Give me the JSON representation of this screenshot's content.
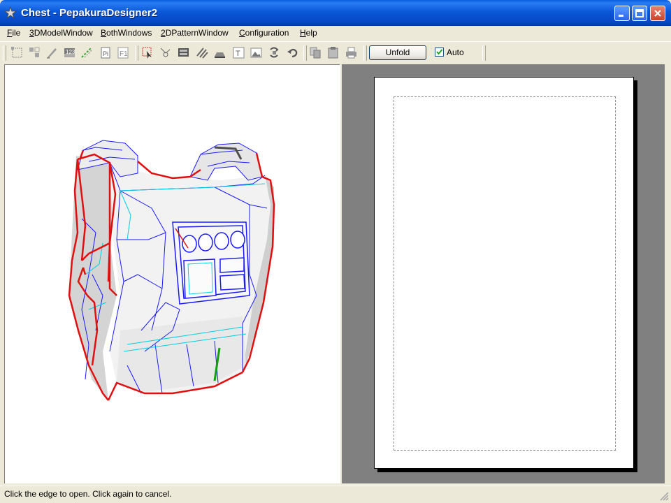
{
  "window": {
    "title": "Chest - PepakuraDesigner2",
    "app_icon": "pepakura-star-icon",
    "controls": [
      "minimize-icon",
      "maximize-icon",
      "close-icon"
    ],
    "colors": {
      "titlebar": "#0a58d8",
      "close_button": "#c8452c"
    }
  },
  "menu": {
    "items": [
      {
        "label": "File",
        "mnemonic": "F",
        "rest": "ile"
      },
      {
        "label": "3DModelWindow",
        "mnemonic": "3",
        "rest": "DModelWindow"
      },
      {
        "label": "BothWindows",
        "mnemonic": "B",
        "rest": "othWindows"
      },
      {
        "label": "2DPatternWindow",
        "mnemonic": "2",
        "rest": "DPatternWindow"
      },
      {
        "label": "Configuration",
        "mnemonic": "C",
        "rest": "onfiguration"
      },
      {
        "label": "Help",
        "mnemonic": "H",
        "rest": "elp"
      }
    ]
  },
  "toolbar": {
    "icons": [
      "select-icon",
      "move-icon",
      "edit-icon",
      "number-icon",
      "edge-icon",
      "page-icon",
      "font-icon",
      "select-face-icon",
      "join-edge-icon",
      "flap-icon",
      "flip-icon",
      "align-icon",
      "text-icon",
      "image-icon",
      "rotate-icon",
      "undo-icon",
      "copy-icon",
      "paste-icon",
      "print-icon"
    ],
    "unfold_label": "Unfold",
    "auto_label": "Auto",
    "auto_checked": true
  },
  "model_view": {
    "colors": {
      "cut_edge": "#e01010",
      "fold_edge": "#1a1aff",
      "crease_edge": "#00d0e0",
      "selected_edge": "#10a010",
      "face": "#e6e6e6"
    }
  },
  "pattern_view": {
    "colors": {
      "background": "#808080",
      "paper": "#ffffff",
      "margin": "#8c8c8c"
    }
  },
  "status": {
    "text": "Click the edge to open. Click again to cancel."
  }
}
